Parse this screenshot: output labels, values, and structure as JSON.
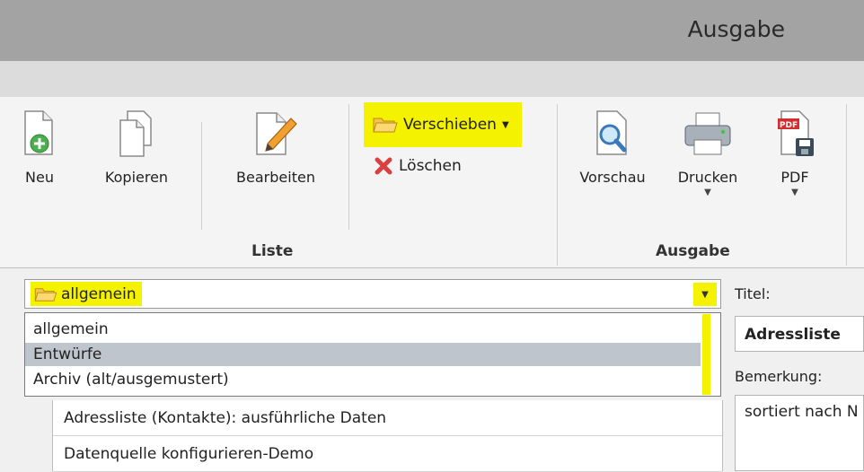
{
  "window": {
    "title": "Ausgabe"
  },
  "ribbon": {
    "liste": {
      "label": "Liste",
      "neu": "Neu",
      "kopieren": "Kopieren",
      "bearbeiten": "Bearbeiten",
      "verschieben": "Verschieben",
      "loeschen": "Löschen"
    },
    "ausgabe": {
      "label": "Ausgabe",
      "vorschau": "Vorschau",
      "drucken": "Drucken",
      "pdf": "PDF",
      "pdf_icon_text": "PDF"
    }
  },
  "folder_select": {
    "value": "allgemein",
    "options": [
      "allgemein",
      "Entwürfe",
      "Archiv (alt/ausgemustert)"
    ],
    "highlighted": "Entwürfe"
  },
  "list": {
    "items": [
      "Adressliste (Kontakte): ausführliche Daten",
      "Datenquelle konfigurieren-Demo"
    ]
  },
  "details": {
    "title_label": "Titel:",
    "title_value": "Adressliste",
    "remark_label": "Bemerkung:",
    "remark_value": "sortiert nach N"
  },
  "colors": {
    "highlight": "#f5f200",
    "selection": "#bfc5cc",
    "titlebar": "#a3a3a3"
  }
}
